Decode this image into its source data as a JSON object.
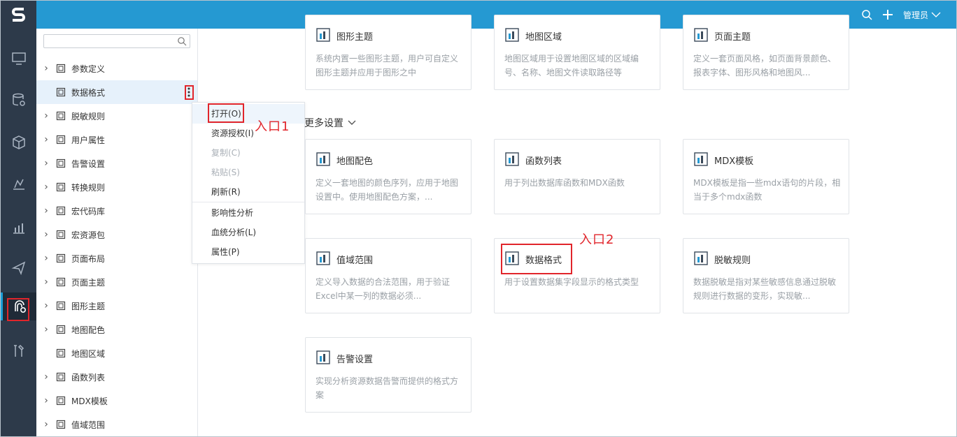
{
  "topbar": {
    "admin_label": "管理员"
  },
  "tree": {
    "search_placeholder": "",
    "items": [
      {
        "label": "参数定义",
        "expandable": true
      },
      {
        "label": "数据格式",
        "expandable": false,
        "selected": true
      },
      {
        "label": "脱敏规则",
        "expandable": true
      },
      {
        "label": "用户属性",
        "expandable": true
      },
      {
        "label": "告警设置",
        "expandable": true
      },
      {
        "label": "转换规则",
        "expandable": true
      },
      {
        "label": "宏代码库",
        "expandable": true
      },
      {
        "label": "宏资源包",
        "expandable": true
      },
      {
        "label": "页面布局",
        "expandable": true
      },
      {
        "label": "页面主题",
        "expandable": true
      },
      {
        "label": "图形主题",
        "expandable": true
      },
      {
        "label": "地图配色",
        "expandable": true
      },
      {
        "label": "地图区域",
        "expandable": false
      },
      {
        "label": "函数列表",
        "expandable": true
      },
      {
        "label": "MDX模板",
        "expandable": true
      },
      {
        "label": "值域范围",
        "expandable": true
      }
    ]
  },
  "context_menu": {
    "items": [
      {
        "label": "打开(O)",
        "disabled": false
      },
      {
        "label": "资源授权(I)",
        "disabled": false
      },
      {
        "label": "复制(C)",
        "disabled": true
      },
      {
        "label": "粘贴(S)",
        "disabled": true
      },
      {
        "label": "刷新(R)",
        "disabled": false
      },
      {
        "label": "影响性分析",
        "disabled": false
      },
      {
        "label": "血统分析(L)",
        "disabled": false
      },
      {
        "label": "属性(P)",
        "disabled": false
      }
    ]
  },
  "annotations": {
    "entry1": "入口1",
    "entry2": "入口2"
  },
  "main": {
    "top_cards": [
      {
        "title": "图形主题",
        "desc": "系统内置一些图形主题，用户可自定义图形主题并应用于图形之中"
      },
      {
        "title": "地图区域",
        "desc": "地图区域用于设置地图区域的区域编号、名称、地图文件读取路径等"
      },
      {
        "title": "页面主题",
        "desc": "定义一套页面风格，如页面背景颜色、报表字体、图形风格和地图风..."
      }
    ],
    "section_title": "更多设置",
    "cards": [
      {
        "title": "地图配色",
        "desc": "定义一套地图的颜色序列，应用于地图设置中。使用地图配色方案，..."
      },
      {
        "title": "函数列表",
        "desc": "用于列出数据库函数和MDX函数"
      },
      {
        "title": "MDX模板",
        "desc": "MDX模板是指一些mdx语句的片段，相当于多个mdx函数"
      },
      {
        "title": "值域范围",
        "desc": "定义导入数据的合法范围，用于验证Excel中某一列的数据必须..."
      },
      {
        "title": "数据格式",
        "desc": "用于设置数据集字段显示的格式类型"
      },
      {
        "title": "脱敏规则",
        "desc": "数据脱敏是指对某些敏感信息通过脱敏规则进行数据的变形，实现敏..."
      },
      {
        "title": "告警设置",
        "desc": "实现分析资源数据告警而提供的格式方案"
      }
    ]
  },
  "colors": {
    "accent": "#2599d2",
    "rail": "#2d3a4a",
    "highlight": "#e1252b"
  }
}
